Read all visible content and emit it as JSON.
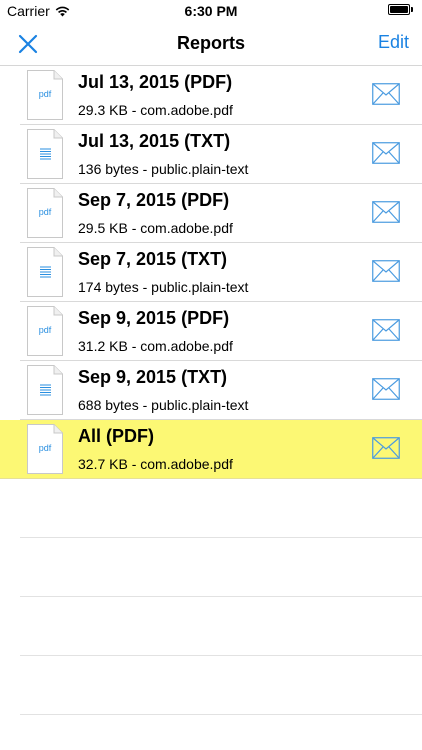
{
  "status_bar": {
    "carrier": "Carrier",
    "time": "6:30 PM",
    "wifi_icon": "wifi-icon",
    "battery_icon": "battery-icon"
  },
  "nav": {
    "close_icon": "close-icon",
    "title": "Reports",
    "edit_label": "Edit"
  },
  "colors": {
    "accent": "#1a82e2",
    "highlight": "#fcf874"
  },
  "reports": [
    {
      "title": "Jul 13, 2015 (PDF)",
      "subtitle": "29.3 KB - com.adobe.pdf",
      "icon_type": "pdf",
      "icon_label": "pdf",
      "highlighted": false
    },
    {
      "title": "Jul 13, 2015 (TXT)",
      "subtitle": "136 bytes - public.plain-text",
      "icon_type": "txt",
      "icon_label": "",
      "highlighted": false
    },
    {
      "title": "Sep 7, 2015 (PDF)",
      "subtitle": "29.5 KB - com.adobe.pdf",
      "icon_type": "pdf",
      "icon_label": "pdf",
      "highlighted": false
    },
    {
      "title": "Sep 7, 2015 (TXT)",
      "subtitle": "174 bytes - public.plain-text",
      "icon_type": "txt",
      "icon_label": "",
      "highlighted": false
    },
    {
      "title": "Sep 9, 2015 (PDF)",
      "subtitle": "31.2 KB - com.adobe.pdf",
      "icon_type": "pdf",
      "icon_label": "pdf",
      "highlighted": false
    },
    {
      "title": "Sep 9, 2015 (TXT)",
      "subtitle": "688 bytes - public.plain-text",
      "icon_type": "txt",
      "icon_label": "",
      "highlighted": false
    },
    {
      "title": "All (PDF)",
      "subtitle": "32.7 KB - com.adobe.pdf",
      "icon_type": "pdf",
      "icon_label": "pdf",
      "highlighted": true
    }
  ]
}
